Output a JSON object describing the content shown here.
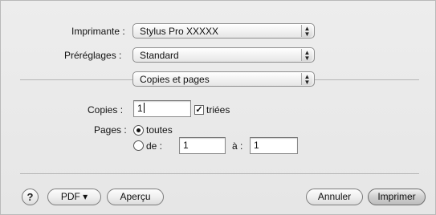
{
  "printer": {
    "label": "Imprimante :",
    "value": "Stylus Pro  XXXXX"
  },
  "presets": {
    "label": "Préréglages :",
    "value": "Standard"
  },
  "section": {
    "value": "Copies et pages"
  },
  "copies": {
    "label": "Copies :",
    "value": "1",
    "collated_label": "triées",
    "collated": true
  },
  "pages": {
    "label": "Pages :",
    "all_label": "toutes",
    "from_label": "de :",
    "from_value": "1",
    "to_label": "à :",
    "to_value": "1",
    "selected": "all"
  },
  "footer": {
    "help_label": "?",
    "pdf_label": "PDF ▾",
    "preview_label": "Aperçu",
    "cancel_label": "Annuler",
    "print_label": "Imprimer"
  },
  "icons": {
    "popup_arrows": "updown-arrows-icon",
    "check": "checkmark-icon"
  },
  "colors": {
    "window_bg": "#e9e9e9",
    "separator": "#b5b5b5"
  }
}
